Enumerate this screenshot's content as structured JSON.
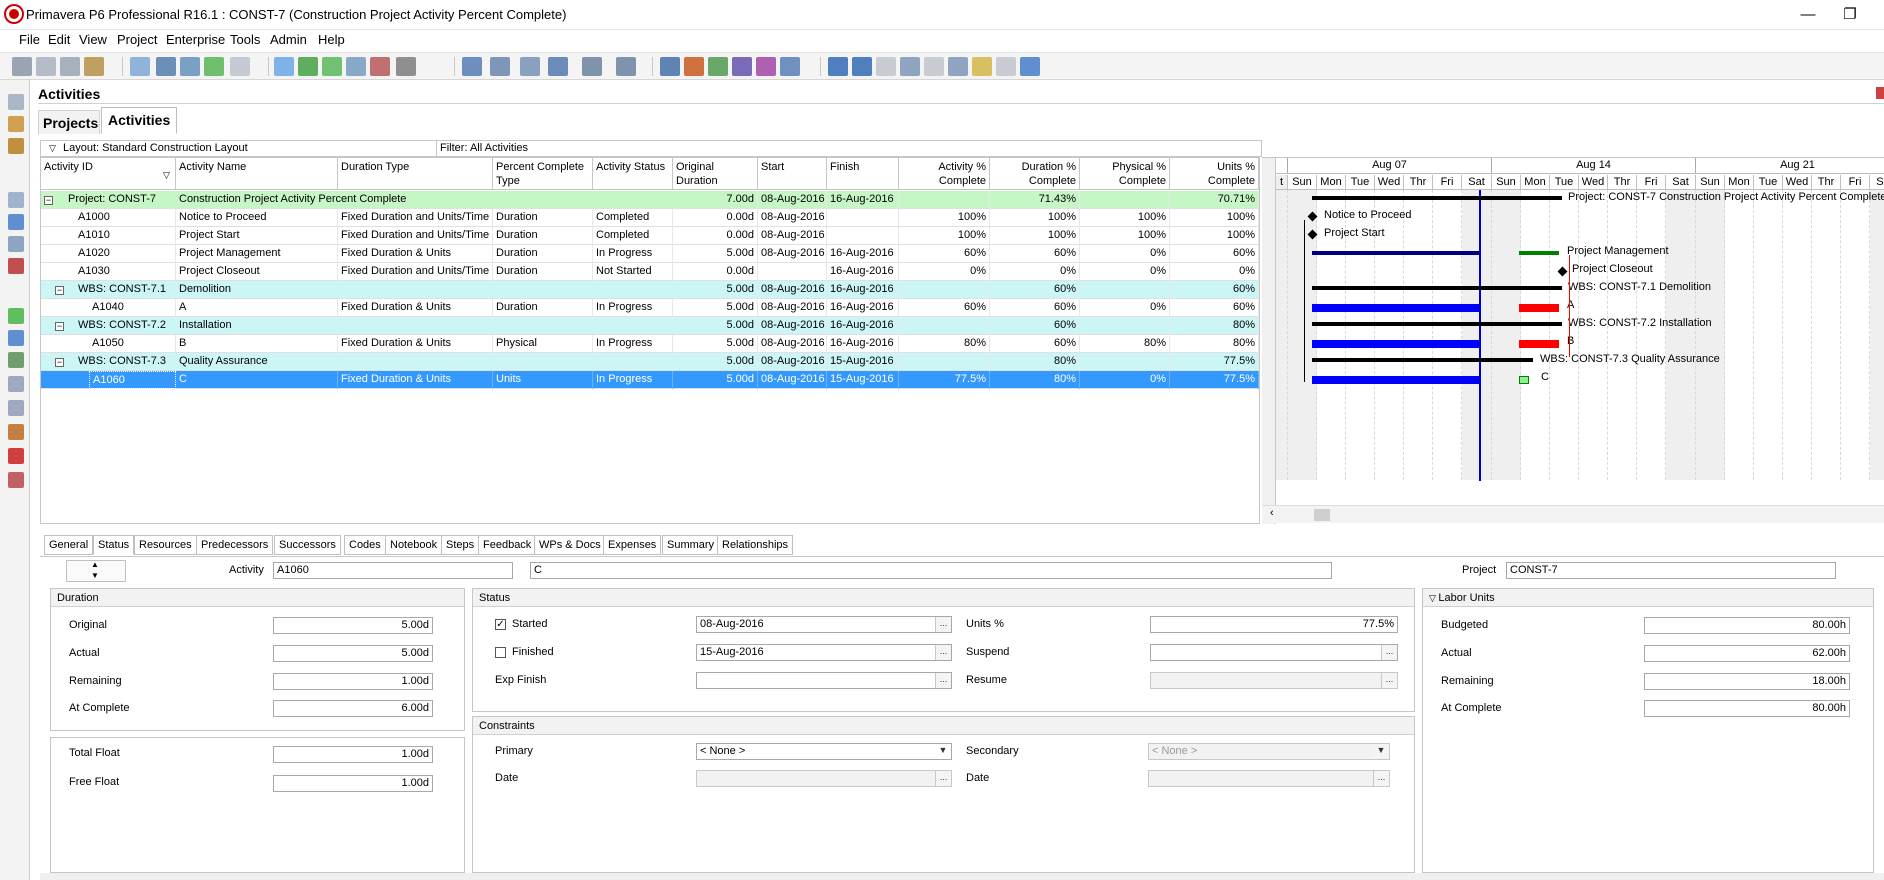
{
  "window": {
    "title": "Primavera P6 Professional R16.1 : CONST-7 (Construction Project Activity Percent Complete)",
    "minimize": "—",
    "restore": "❐"
  },
  "menu": [
    "File",
    "Edit",
    "View",
    "Project",
    "Enterprise",
    "Tools",
    "Admin",
    "Help"
  ],
  "area": {
    "title": "Activities",
    "tabs": [
      "Projects",
      "Activities"
    ]
  },
  "layout": {
    "label": "Layout: Standard Construction Layout",
    "filter": "Filter: All Activities"
  },
  "columns": [
    {
      "label": "Activity ID"
    },
    {
      "label": "Activity Name"
    },
    {
      "label": "Duration Type"
    },
    {
      "label": "Percent Complete Type"
    },
    {
      "label": "Activity Status"
    },
    {
      "label": "Original Duration"
    },
    {
      "label": "Start"
    },
    {
      "label": "Finish"
    },
    {
      "label": "Activity % Complete"
    },
    {
      "label": "Duration % Complete"
    },
    {
      "label": "Physical % Complete"
    },
    {
      "label": "Units % Complete"
    }
  ],
  "rows": {
    "project": {
      "id": "Project: CONST-7",
      "name": "Construction Project Activity Percent Complete",
      "orig": "7.00d",
      "start": "08-Aug-2016",
      "finish": "16-Aug-2016",
      "dur_pct": "71.43%",
      "units_pct": "70.71%"
    },
    "a1000": {
      "id": "A1000",
      "name": "Notice to Proceed",
      "dtype": "Fixed Duration and Units/Time",
      "ptype": "Duration",
      "status": "Completed",
      "orig": "0.00d",
      "start": "08-Aug-2016",
      "finish": "",
      "act_pct": "100%",
      "dur_pct": "100%",
      "phys_pct": "100%",
      "units_pct": "100%"
    },
    "a1010": {
      "id": "A1010",
      "name": "Project Start",
      "dtype": "Fixed Duration and Units/Time",
      "ptype": "Duration",
      "status": "Completed",
      "orig": "0.00d",
      "start": "08-Aug-2016",
      "finish": "",
      "act_pct": "100%",
      "dur_pct": "100%",
      "phys_pct": "100%",
      "units_pct": "100%"
    },
    "a1020": {
      "id": "A1020",
      "name": "Project Management",
      "dtype": "Fixed Duration & Units",
      "ptype": "Duration",
      "status": "In Progress",
      "orig": "5.00d",
      "start": "08-Aug-2016",
      "finish": "16-Aug-2016",
      "act_pct": "60%",
      "dur_pct": "60%",
      "phys_pct": "0%",
      "units_pct": "60%"
    },
    "a1030": {
      "id": "A1030",
      "name": "Project Closeout",
      "dtype": "Fixed Duration and Units/Time",
      "ptype": "Duration",
      "status": "Not Started",
      "orig": "0.00d",
      "start": "",
      "finish": "16-Aug-2016",
      "act_pct": "0%",
      "dur_pct": "0%",
      "phys_pct": "0%",
      "units_pct": "0%"
    },
    "wbs1": {
      "id": "WBS: CONST-7.1",
      "name": "Demolition",
      "orig": "5.00d",
      "start": "08-Aug-2016",
      "finish": "16-Aug-2016",
      "dur_pct": "60%",
      "units_pct": "60%"
    },
    "a1040": {
      "id": "A1040",
      "name": "A",
      "dtype": "Fixed Duration & Units",
      "ptype": "Duration",
      "status": "In Progress",
      "orig": "5.00d",
      "start": "08-Aug-2016",
      "finish": "16-Aug-2016",
      "act_pct": "60%",
      "dur_pct": "60%",
      "phys_pct": "0%",
      "units_pct": "60%"
    },
    "wbs2": {
      "id": "WBS: CONST-7.2",
      "name": "Installation",
      "orig": "5.00d",
      "start": "08-Aug-2016",
      "finish": "16-Aug-2016",
      "dur_pct": "60%",
      "units_pct": "80%"
    },
    "a1050": {
      "id": "A1050",
      "name": "B",
      "dtype": "Fixed Duration & Units",
      "ptype": "Physical",
      "status": "In Progress",
      "orig": "5.00d",
      "start": "08-Aug-2016",
      "finish": "16-Aug-2016",
      "act_pct": "80%",
      "dur_pct": "60%",
      "phys_pct": "80%",
      "units_pct": "80%"
    },
    "wbs3": {
      "id": "WBS: CONST-7.3",
      "name": "Quality Assurance",
      "orig": "5.00d",
      "start": "08-Aug-2016",
      "finish": "15-Aug-2016",
      "dur_pct": "80%",
      "units_pct": "77.5%"
    },
    "a1060": {
      "id": "A1060",
      "name": "C",
      "dtype": "Fixed Duration & Units",
      "ptype": "Units",
      "status": "In Progress",
      "orig": "5.00d",
      "start": "08-Aug-2016",
      "finish": "15-Aug-2016",
      "act_pct": "77.5%",
      "dur_pct": "80%",
      "phys_pct": "0%",
      "units_pct": "77.5%"
    }
  },
  "gantt": {
    "weeks": [
      "Aug 07",
      "Aug 14",
      "Aug 21"
    ],
    "edge_day": "t",
    "days": [
      "Sun",
      "Mon",
      "Tue",
      "Wed",
      "Thr",
      "Fri",
      "Sat",
      "Sun",
      "Mon",
      "Tue",
      "Wed",
      "Thr",
      "Fri",
      "Sat",
      "Sun",
      "Mon",
      "Tue",
      "Wed",
      "Thr",
      "Fri",
      "Sat"
    ],
    "labels": {
      "project": "Project: CONST-7  Construction Project Activity Percent Complete",
      "a1000": "Notice to Proceed",
      "a1010": "Project Start",
      "a1020": "Project Management",
      "a1030": "Project Closeout",
      "wbs1": "WBS: CONST-7.1  Demolition",
      "a1040": "A",
      "wbs2": "WBS: CONST-7.2  Installation",
      "a1050": "B",
      "wbs3": "WBS: CONST-7.3  Quality Assurance",
      "a1060": "C"
    },
    "colors": {
      "actual": "#0000ff",
      "remaining": "#ff0000",
      "summary": "#000000",
      "data_date": "#0000cc",
      "pm_bar": "#008000"
    }
  },
  "detail": {
    "tabs": [
      "General",
      "Status",
      "Resources",
      "Predecessors",
      "Successors",
      "Codes",
      "Notebook",
      "Steps",
      "Feedback",
      "WPs & Docs",
      "Expenses",
      "Summary",
      "Relationships"
    ],
    "activity_label": "Activity",
    "activity_id": "A1060",
    "activity_name": "C",
    "project_label": "Project",
    "project_value": "CONST-7",
    "duration": {
      "title": "Duration",
      "original_label": "Original",
      "original": "5.00d",
      "actual_label": "Actual",
      "actual": "5.00d",
      "remaining_label": "Remaining",
      "remaining": "1.00d",
      "at_complete_label": "At Complete",
      "at_complete": "6.00d"
    },
    "float": {
      "total_label": "Total Float",
      "total": "1.00d",
      "free_label": "Free Float",
      "free": "1.00d"
    },
    "status": {
      "title": "Status",
      "started_label": "Started",
      "started": "08-Aug-2016",
      "finished_label": "Finished",
      "finished": "15-Aug-2016",
      "exp_finish_label": "Exp Finish",
      "units_pct_label": "Units %",
      "units_pct": "77.5%",
      "suspend_label": "Suspend",
      "resume_label": "Resume"
    },
    "constraints": {
      "title": "Constraints",
      "primary_label": "Primary",
      "primary": "< None >",
      "secondary_label": "Secondary",
      "secondary": "< None >",
      "date_label": "Date",
      "date2_label": "Date"
    },
    "labor": {
      "title": "Labor Units",
      "budgeted_label": "Budgeted",
      "budgeted": "80.00h",
      "actual_label": "Actual",
      "actual": "62.00h",
      "remaining_label": "Remaining",
      "remaining": "18.00h",
      "at_complete_label": "At Complete",
      "at_complete": "80.00h"
    }
  }
}
